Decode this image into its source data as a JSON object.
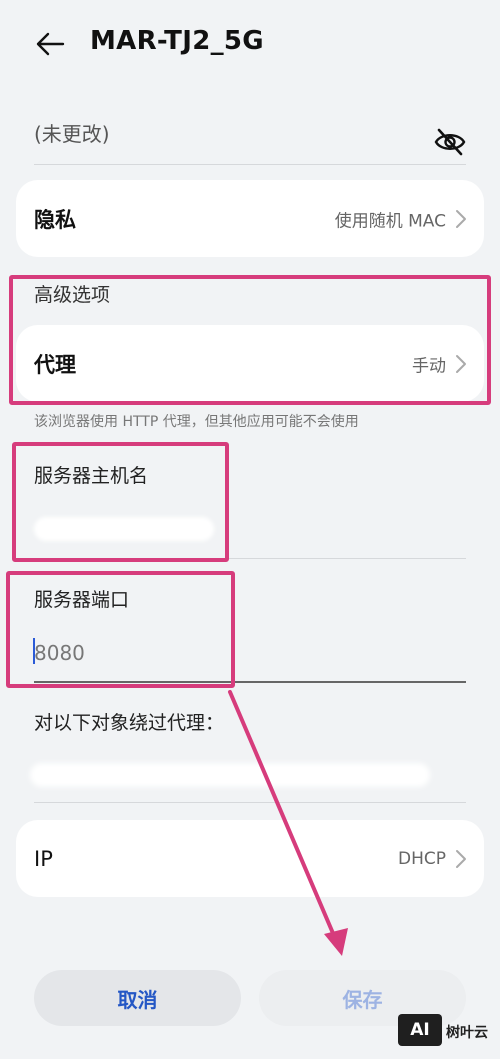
{
  "header": {
    "title": "MAR-TJ2_5G",
    "back_icon": "arrow-left-icon"
  },
  "password": {
    "value": "(未更改)",
    "toggle_icon": "eye-off-icon"
  },
  "privacy": {
    "label": "隐私",
    "value": "使用随机 MAC"
  },
  "advanced": {
    "section_title": "高级选项",
    "proxy": {
      "label": "代理",
      "value": "手动"
    },
    "hint": "该浏览器使用 HTTP 代理，但其他应用可能不会使用"
  },
  "fields": {
    "host": {
      "label": "服务器主机名"
    },
    "port": {
      "label": "服务器端口",
      "value": "8080"
    },
    "bypass": {
      "label": "对以下对象绕过代理："
    }
  },
  "ip": {
    "label": "IP",
    "value": "DHCP"
  },
  "footer": {
    "cancel_label": "取消",
    "save_label": "保存"
  },
  "watermark": {
    "logo": "AI",
    "text": "树叶云"
  },
  "colors": {
    "accent": "#2457c5",
    "annotation": "#d63c7c",
    "background": "#f1f3f5"
  }
}
